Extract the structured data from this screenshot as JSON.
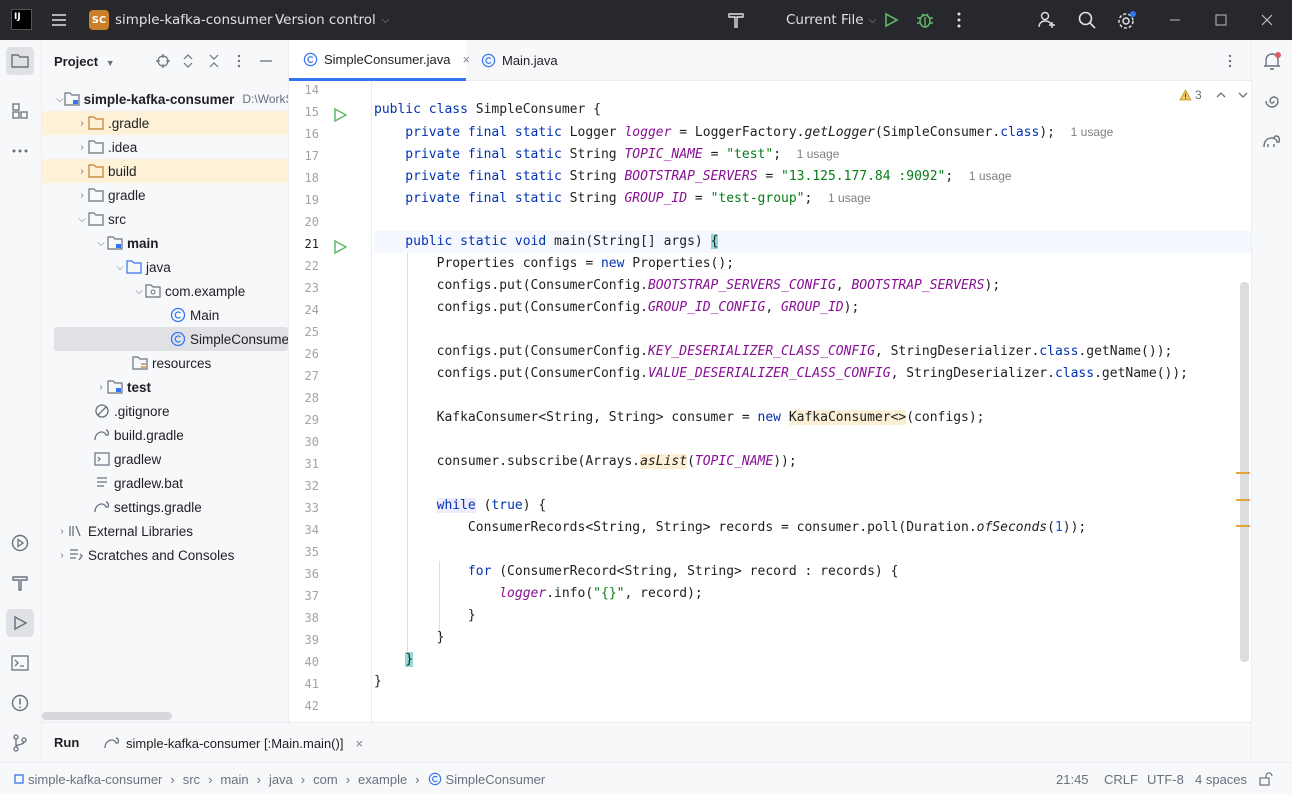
{
  "titlebar": {
    "project_badge": "SC",
    "project_name": "simple-kafka-consumer",
    "version_control": "Version control",
    "run_config": "Current File"
  },
  "project_panel": {
    "title": "Project",
    "tree": [
      {
        "label": "simple-kafka-consumer",
        "extra": "D:\\WorkS",
        "bold": true
      },
      {
        "label": ".gradle"
      },
      {
        "label": ".idea"
      },
      {
        "label": "build"
      },
      {
        "label": "gradle"
      },
      {
        "label": "src"
      },
      {
        "label": "main",
        "bold": true
      },
      {
        "label": "java"
      },
      {
        "label": "com.example"
      },
      {
        "label": "Main"
      },
      {
        "label": "SimpleConsumer"
      },
      {
        "label": "resources"
      },
      {
        "label": "test",
        "bold": true
      },
      {
        "label": ".gitignore"
      },
      {
        "label": "build.gradle"
      },
      {
        "label": "gradlew"
      },
      {
        "label": "gradlew.bat"
      },
      {
        "label": "settings.gradle"
      },
      {
        "label": "External Libraries"
      },
      {
        "label": "Scratches and Consoles"
      }
    ]
  },
  "tabs": [
    {
      "label": "SimpleConsumer.java",
      "active": true
    },
    {
      "label": "Main.java",
      "active": false
    }
  ],
  "inspections": {
    "warnings": "3"
  },
  "code": {
    "line_numbers": [
      "14",
      "15",
      "16",
      "17",
      "18",
      "19",
      "20",
      "21",
      "22",
      "23",
      "24",
      "25",
      "26",
      "27",
      "28",
      "29",
      "30",
      "31",
      "32",
      "33",
      "34",
      "35",
      "36",
      "37",
      "38",
      "39",
      "40",
      "41",
      "42"
    ],
    "usage_hint": "1 usage",
    "l15": {
      "a": "public class ",
      "b": "SimpleConsumer {"
    },
    "l16": {
      "a": "    private final static ",
      "b": "Logger ",
      "c": "logger",
      "d": " = LoggerFactory.",
      "e": "getLogger",
      "f": "(SimpleConsumer.",
      "g": "class",
      "h": ");"
    },
    "l17": {
      "a": "    private final static ",
      "b": "String ",
      "c": "TOPIC_NAME",
      "d": " = ",
      "e": "\"test\"",
      "f": ";"
    },
    "l18": {
      "a": "    private final static ",
      "b": "String ",
      "c": "BOOTSTRAP_SERVERS",
      "d": " = ",
      "e": "\"13.125.177.84 :9092\"",
      "f": ";"
    },
    "l19": {
      "a": "    private final static ",
      "b": "String ",
      "c": "GROUP_ID",
      "d": " = ",
      "e": "\"test-group\"",
      "f": ";"
    },
    "l21": {
      "a": "    public static void ",
      "b": "main(String[] args) ",
      "c": "{"
    },
    "l22": {
      "a": "        Properties configs = ",
      "b": "new",
      "c": " Properties();"
    },
    "l23": {
      "a": "        configs.put(ConsumerConfig.",
      "b": "BOOTSTRAP_SERVERS_CONFIG",
      "c": ", ",
      "d": "BOOTSTRAP_SERVERS",
      "e": ");"
    },
    "l24": {
      "a": "        configs.put(ConsumerConfig.",
      "b": "GROUP_ID_CONFIG",
      "c": ", ",
      "d": "GROUP_ID",
      "e": ");"
    },
    "l26": {
      "a": "        configs.put(ConsumerConfig.",
      "b": "KEY_DESERIALIZER_CLASS_CONFIG",
      "c": ", StringDeserializer.",
      "d": "class",
      "e": ".getName());"
    },
    "l27": {
      "a": "        configs.put(ConsumerConfig.",
      "b": "VALUE_DESERIALIZER_CLASS_CONFIG",
      "c": ", StringDeserializer.",
      "d": "class",
      "e": ".getName());"
    },
    "l29": {
      "a": "        KafkaConsumer<String, String> consumer = ",
      "b": "new",
      "c": " ",
      "d": "KafkaConsumer<>",
      "e": "(configs);"
    },
    "l31": {
      "a": "        consumer.subscribe(Arrays.",
      "b": "asList",
      "c": "(",
      "d": "TOPIC_NAME",
      "e": "));"
    },
    "l33": {
      "a": "        ",
      "b": "while",
      "c": " (",
      "d": "true",
      "e": ") {"
    },
    "l34": {
      "a": "            ConsumerRecords<String, String> records = consumer.poll(Duration.",
      "b": "ofSeconds",
      "c": "(",
      "d": "1",
      "e": "));"
    },
    "l36": {
      "a": "            ",
      "b": "for",
      "c": " (ConsumerRecord<String, String> record : records) {"
    },
    "l37": {
      "a": "                ",
      "b": "logger",
      "c": ".info(",
      "d": "\"{}\"",
      "e": ", record);"
    },
    "l38": {
      "a": "            }"
    },
    "l39": {
      "a": "        }"
    },
    "l40": {
      "a": "    ",
      "b": "}"
    },
    "l41": {
      "a": "}"
    }
  },
  "runbar": {
    "label": "Run",
    "tab_label": "simple-kafka-consumer [:Main.main()]"
  },
  "status": {
    "breadcrumbs": [
      "simple-kafka-consumer",
      "src",
      "main",
      "java",
      "com",
      "example",
      "SimpleConsumer"
    ],
    "position": "21:45",
    "line_sep": "CRLF",
    "encoding": "UTF-8",
    "indent": "4 spaces"
  },
  "colors": {
    "accent": "#3574f0",
    "titlebar": "#27282e",
    "keyword": "#0033b3",
    "field": "#871094",
    "string": "#067d17"
  }
}
